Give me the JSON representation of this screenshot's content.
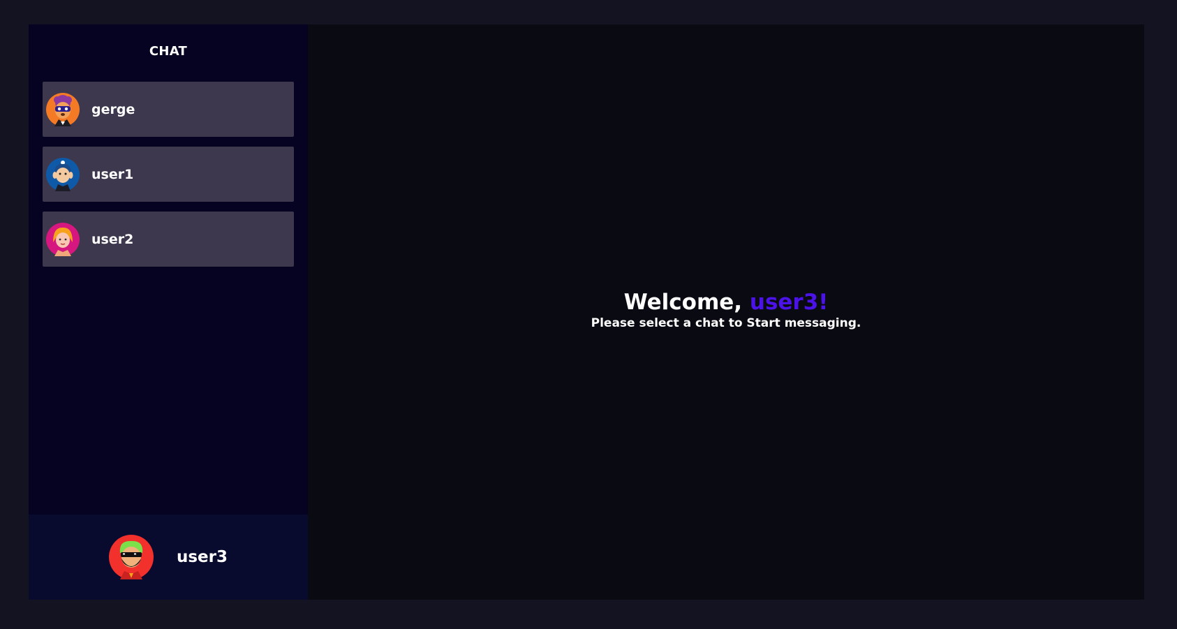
{
  "sidebar": {
    "title": "CHAT",
    "chats": [
      {
        "name": "gerge",
        "avatar": "masked-raccoon-avatar",
        "color": "#f47a26"
      },
      {
        "name": "user1",
        "avatar": "old-man-beard-avatar",
        "color": "#0f5aa8"
      },
      {
        "name": "user2",
        "avatar": "blonde-woman-avatar",
        "color": "#d6177f"
      }
    ]
  },
  "current_user": {
    "name": "user3",
    "avatar": "sunglasses-beard-avatar",
    "color": "#f2312d"
  },
  "main": {
    "welcome_prefix": "Welcome, ",
    "welcome_user": "user3!",
    "subtitle": "Please select a chat to Start messaging."
  },
  "colors": {
    "page_bg": "#131322",
    "sidebar_bg": "#050222",
    "chat_item_bg": "#3d384d",
    "footer_bg": "#080b2e",
    "main_bg": "#090a12",
    "accent": "#4b13e8"
  }
}
